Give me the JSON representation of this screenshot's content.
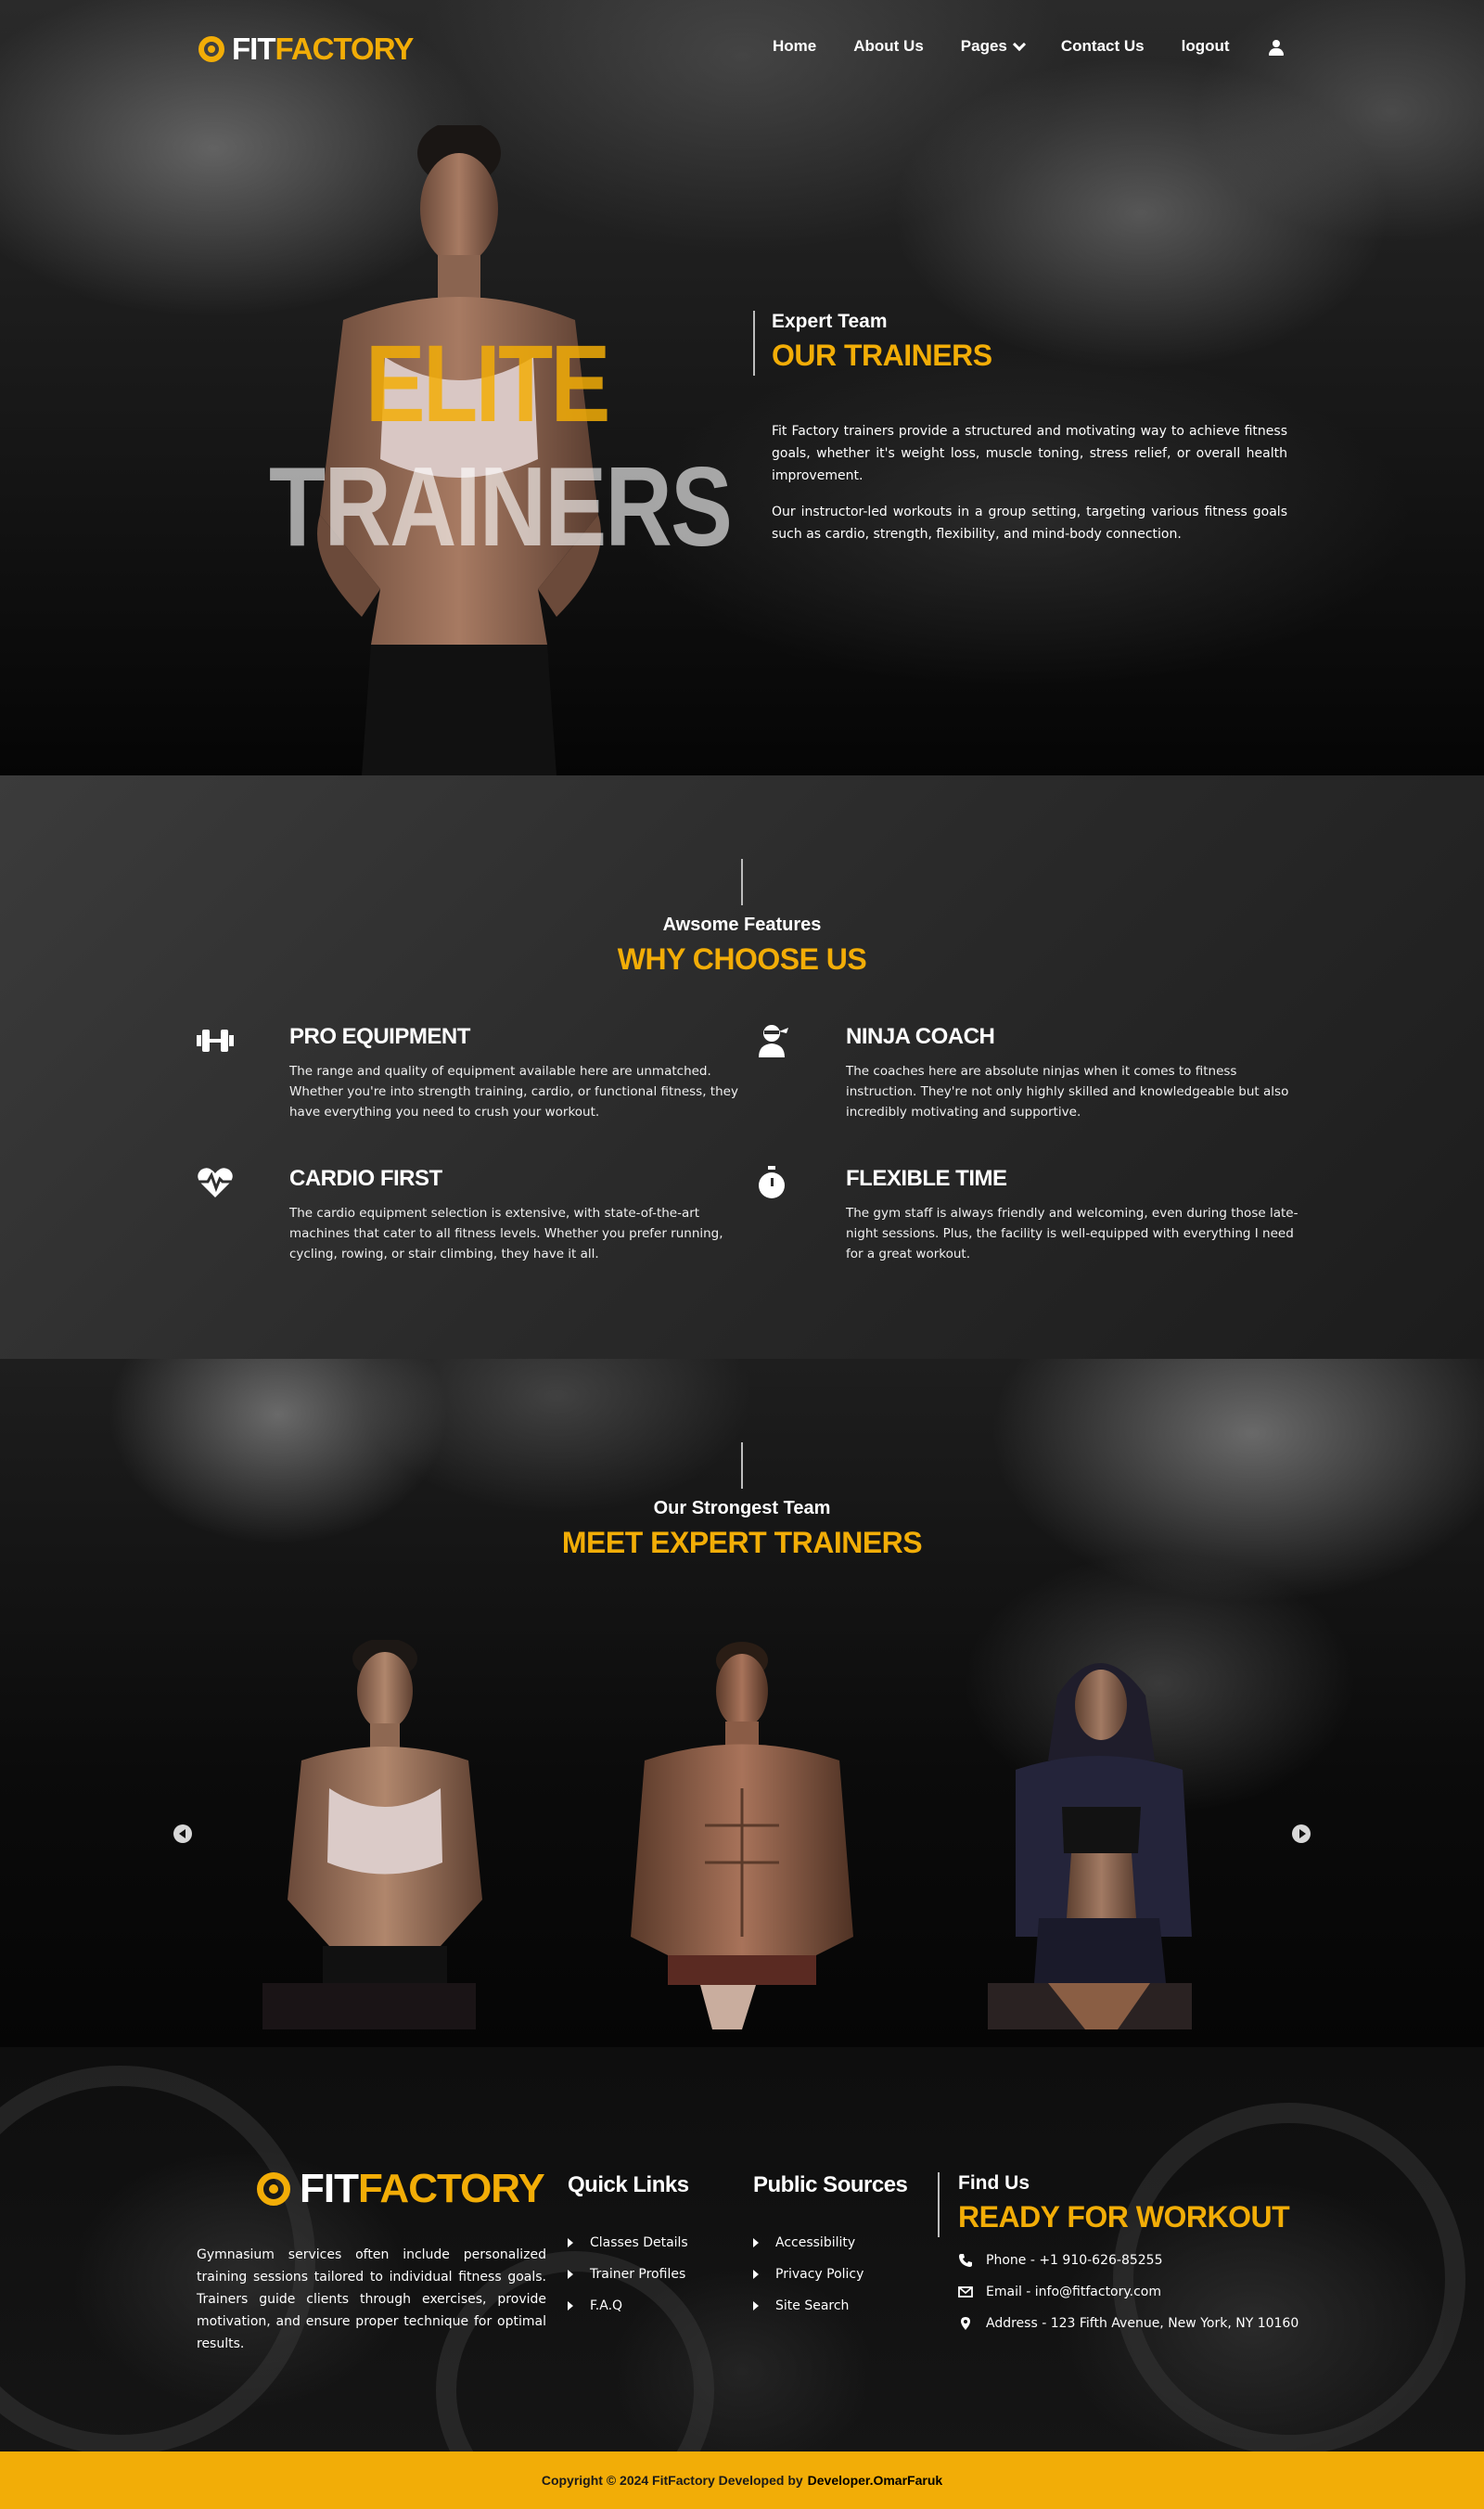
{
  "brand": {
    "fit": "FIT",
    "factory": "FACTORY"
  },
  "nav": {
    "items": [
      "Home",
      "About Us",
      "Pages",
      "Contact Us",
      "logout"
    ]
  },
  "hero": {
    "big_word_1": "ELITE",
    "big_word_2": "TRAINERS",
    "subtitle": "Expert Team",
    "title": "OUR TRAINERS",
    "p1": "Fit Factory trainers provide a structured and motivating way to achieve fitness goals, whether it's weight loss, muscle toning, stress relief, or overall health improvement.",
    "p2": "Our instructor-led workouts in a group setting, targeting various fitness goals such as cardio, strength, flexibility, and mind-body connection."
  },
  "why": {
    "subtitle": "Awsome Features",
    "title": "WHY CHOOSE US",
    "features": [
      {
        "title": "PRO EQUIPMENT",
        "text": "The range and quality of equipment available here are unmatched. Whether you're into strength training, cardio, or functional fitness, they have everything you need to crush your workout.",
        "icon": "dumbbell-icon"
      },
      {
        "title": "NINJA COACH",
        "text": "The coaches here are absolute ninjas when it comes to fitness instruction. They're not only highly skilled and knowledgeable but also incredibly motivating and supportive.",
        "icon": "ninja-icon"
      },
      {
        "title": "CARDIO FIRST",
        "text": "The cardio equipment selection is extensive, with state-of-the-art machines that cater to all fitness levels. Whether you prefer running, cycling, rowing, or stair climbing, they have it all.",
        "icon": "heartbeat-icon"
      },
      {
        "title": "FLEXIBLE TIME",
        "text": "The gym staff is always friendly and welcoming, even during those late-night sessions. Plus, the facility is well-equipped with everything I need for a great workout.",
        "icon": "stopwatch-icon"
      }
    ]
  },
  "team": {
    "subtitle": "Our Strongest Team",
    "title": "MEET EXPERT TRAINERS"
  },
  "footer": {
    "about": "Gymnasium services often include personalized training sessions tailored to individual fitness goals. Trainers guide clients through exercises, provide motivation, and ensure proper technique for optimal results.",
    "quick_links_title": "Quick Links",
    "quick_links": [
      "Classes Details",
      "Trainer Profiles",
      "F.A.Q"
    ],
    "public_title": "Public Sources",
    "public_links": [
      "Accessibility",
      "Privacy Policy",
      "Site Search"
    ],
    "find_us": "Find Us",
    "ready": "READY FOR WORKOUT",
    "phone": "Phone - +1 910-626-85255",
    "email": "Email - info@fitfactory.com",
    "address": "Address - 123 Fifth Avenue, New York, NY 10160",
    "copyright": "Copyright © 2024 FitFactory Developed by",
    "developer": "Developer.OmarFaruk"
  },
  "colors": {
    "accent": "#f2ad07",
    "dark": "#1a1a1a"
  }
}
